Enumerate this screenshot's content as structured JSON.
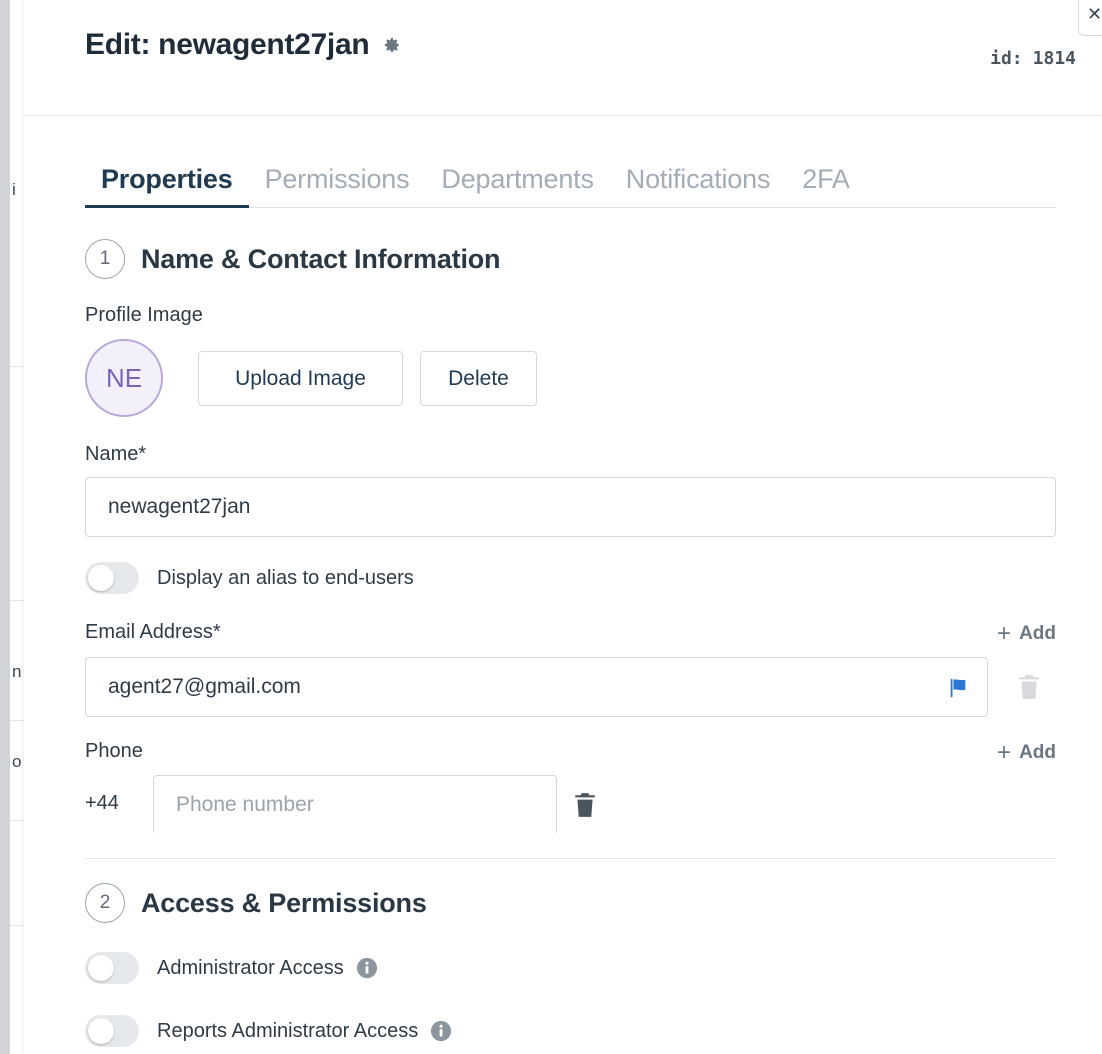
{
  "background": {
    "fragments": [
      "i",
      "n",
      "o"
    ]
  },
  "header": {
    "title": "Edit: newagent27jan",
    "id_label": "id:",
    "id_value": "1814"
  },
  "tabs": [
    {
      "label": "Properties",
      "active": true
    },
    {
      "label": "Permissions",
      "active": false
    },
    {
      "label": "Departments",
      "active": false
    },
    {
      "label": "Notifications",
      "active": false
    },
    {
      "label": "2FA",
      "active": false
    }
  ],
  "section1": {
    "number": "1",
    "title": "Name & Contact Information",
    "profile_image_label": "Profile Image",
    "avatar_initials": "NE",
    "upload_label": "Upload Image",
    "delete_label": "Delete",
    "name_label": "Name*",
    "name_value": "newagent27jan",
    "alias_toggle_label": "Display an alias to end-users",
    "email_label": "Email Address*",
    "email_value": "agent27@gmail.com",
    "add_label": "Add",
    "phone_label": "Phone",
    "phone_country_code": "+44",
    "phone_placeholder": "Phone number"
  },
  "section2": {
    "number": "2",
    "title": "Access & Permissions",
    "admin_access_label": "Administrator Access",
    "reports_admin_label": "Reports Administrator Access"
  },
  "colors": {
    "accent": "#1f3b54",
    "flag_blue": "#2b78d4",
    "avatar_border": "#b8a8d8"
  }
}
